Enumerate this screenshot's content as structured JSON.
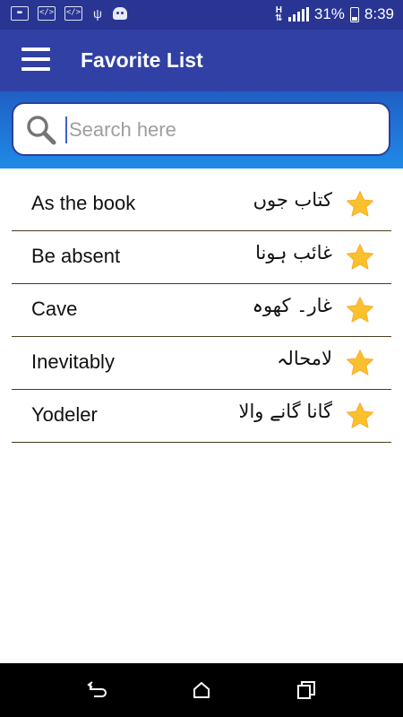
{
  "status_bar": {
    "battery": "31%",
    "time": "8:39",
    "network_type": "H"
  },
  "app_bar": {
    "title": "Favorite List"
  },
  "search": {
    "placeholder": "Search here",
    "value": ""
  },
  "favorites": [
    {
      "english": "As the book",
      "urdu": "کتاب جوں"
    },
    {
      "english": "Be absent",
      "urdu": "غائب ہونا"
    },
    {
      "english": "Cave",
      "urdu": "غار۔ کھوہ"
    },
    {
      "english": "Inevitably",
      "urdu": "لامحالہ"
    },
    {
      "english": "Yodeler",
      "urdu": "گانا گانے والا"
    }
  ],
  "colors": {
    "status_bar": "#283593",
    "app_bar": "#3040a5",
    "search_band": "#1f8ae8",
    "star": "#fbc02d",
    "divider": "#4a3b1f"
  },
  "icons": {
    "menu": "hamburger-icon",
    "search": "search-icon",
    "favorite": "star-icon",
    "back": "back-icon",
    "home": "home-icon",
    "recents": "recents-icon"
  }
}
